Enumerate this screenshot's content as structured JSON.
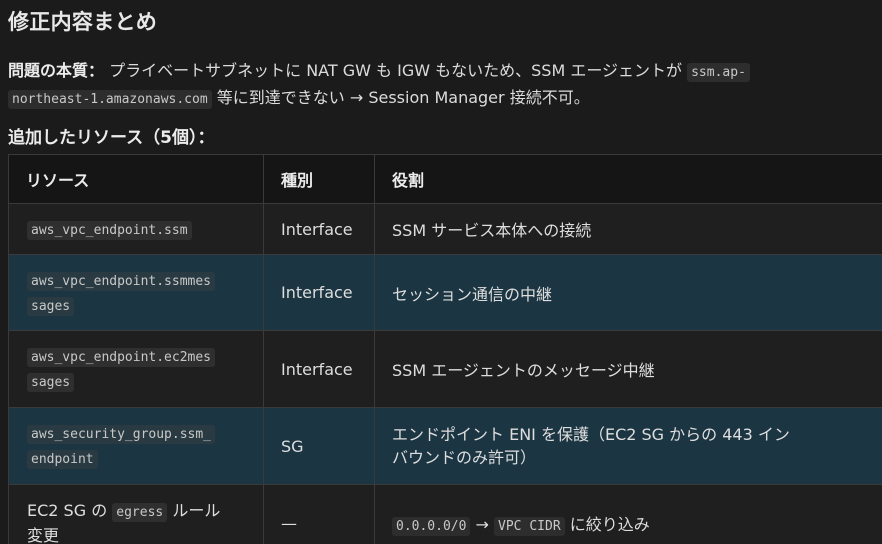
{
  "heading": "修正内容まとめ",
  "problem": {
    "label": "問題の本質：",
    "text1": " プライベートサブネットに NAT GW も IGW もないため、SSM エージェントが ",
    "code1a": "ssm.ap-",
    "code1b": "northeast-1.amazonaws.com",
    "text2": " 等に到達できない → Session Manager 接続不可。"
  },
  "subheading": "追加したリソース（5個）：",
  "table": {
    "headers": [
      "リソース",
      "種別",
      "役割"
    ],
    "rows": [
      {
        "resource_lines": [
          "aws_vpc_endpoint.ssm"
        ],
        "kind": "Interface",
        "role": "SSM サービス本体への接続"
      },
      {
        "resource_lines": [
          "aws_vpc_endpoint.ssmmes",
          "sages"
        ],
        "kind": "Interface",
        "role": "セッション通信の中継"
      },
      {
        "resource_lines": [
          "aws_vpc_endpoint.ec2mes",
          "sages"
        ],
        "kind": "Interface",
        "role": "SSM エージェントのメッセージ中継"
      },
      {
        "resource_lines": [
          "aws_security_group.ssm_",
          "endpoint"
        ],
        "kind": "SG",
        "role_lines": [
          "エンドポイント ENI を保護（EC2 SG からの 443 イン",
          "バウンドのみ許可）"
        ]
      },
      {
        "resource_prefix": "EC2 SG の ",
        "resource_code": "egress",
        "resource_suffix": " ルール",
        "resource_line2": "変更",
        "kind": "—",
        "role_code1": "0.0.0.0/0",
        "role_arrow": " → ",
        "role_code2": "VPC CIDR",
        "role_suffix": " に絞り込み"
      }
    ]
  }
}
